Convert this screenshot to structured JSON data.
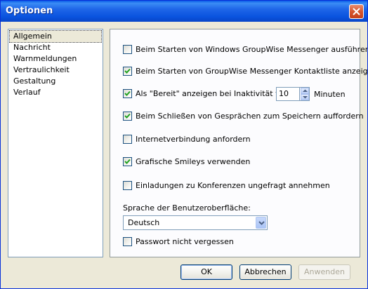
{
  "window": {
    "title": "Optionen"
  },
  "nav": {
    "items": [
      "Allgemein",
      "Nachricht",
      "Warnmeldungen",
      "Vertraulichkeit",
      "Gestaltung",
      "Verlauf"
    ],
    "selected": 0
  },
  "settings": {
    "options": [
      {
        "label": "Beim Starten von Windows GroupWise Messenger ausführen",
        "checked": false
      },
      {
        "label": "Beim Starten von GroupWise Messenger Kontaktliste anzeigen",
        "checked": true
      },
      {
        "label": "Als \"Bereit\" anzeigen bei Inaktivität von",
        "checked": true
      },
      {
        "label": "Beim Schließen von Gesprächen zum Speichern auffordern",
        "checked": true
      },
      {
        "label": "Internetverbindung anfordern",
        "checked": false
      },
      {
        "label": "Grafische Smileys verwenden",
        "checked": true
      },
      {
        "label": "Einladungen zu Konferenzen ungefragt annehmen",
        "checked": false
      }
    ],
    "inactivity_value": "10",
    "inactivity_unit": "Minuten",
    "language_label": "Sprache der Benutzeroberfläche:",
    "language_value": "Deutsch",
    "remember_password": {
      "label": "Passwort nicht vergessen",
      "checked": false
    }
  },
  "buttons": {
    "ok": "OK",
    "cancel": "Abbrechen",
    "apply": "Anwenden"
  }
}
